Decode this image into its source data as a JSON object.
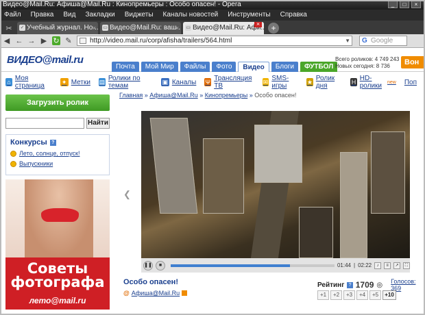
{
  "window": {
    "title": "Видео@Mail.Ru: Афиша@Mail.Ru : Кинопремьеры : Особо опасен! - Opera"
  },
  "menu": [
    "Файл",
    "Правка",
    "Вид",
    "Закладки",
    "Виджеты",
    "Каналы новостей",
    "Инструменты",
    "Справка"
  ],
  "tabs": [
    {
      "label": "Учебный журнал. Но ..."
    },
    {
      "label": "Видео@Mail.Ru: ваш ..."
    },
    {
      "label": "Видео@Mail.Ru: Афи..."
    }
  ],
  "address": {
    "url": "http://video.mail.ru/corp/afisha/trailers/564.html",
    "search_placeholder": "Google"
  },
  "site": {
    "logo": "ВИДЕО@mail.ru",
    "tabs": [
      "Почта",
      "Мой Мир",
      "Файлы",
      "Фото",
      "Видео",
      "Блоги",
      "ФУТБОЛ"
    ],
    "stats_line1": "Всего роликов: 4 749 243",
    "stats_line2": "Новых сегодня: 8 736",
    "orange_btn": "Вон"
  },
  "links": [
    {
      "label": "Моя страница",
      "icon": "home-icon",
      "color": "#3a8fd8"
    },
    {
      "label": "Метки",
      "icon": "tag-icon",
      "color": "#f0a000"
    },
    {
      "label": "Ролики по темам",
      "icon": "film-icon",
      "color": "#3a8fd8"
    },
    {
      "label": "Каналы",
      "icon": "tv-icon",
      "color": "#3a6fc0"
    },
    {
      "label": "Трансляция ТВ",
      "icon": "antenna-icon",
      "color": "#e06a00"
    },
    {
      "label": "SMS-игры",
      "icon": "sms-icon",
      "color": "#f0b400"
    },
    {
      "label": "Ролик дня",
      "icon": "clapper-icon",
      "color": "#d0a000"
    },
    {
      "label": "HD-ролики",
      "icon": "hd-icon",
      "color": "#333333",
      "badge": "new"
    },
    {
      "label": "Поп",
      "icon": "",
      "color": ""
    }
  ],
  "sidebar": {
    "upload": "Загрузить ролик",
    "search_btn": "Найти",
    "contests_title": "Конкурсы",
    "contests": [
      "Лето, солнце, отпуск!",
      "Выпускники"
    ],
    "ad_line1": "Советы",
    "ad_line2": "фотографа",
    "ad_brand": "лето@mail.ru"
  },
  "breadcrumbs": {
    "items": [
      "Главная",
      "Афиша@Mail.Ru",
      "Кинопремьеры"
    ],
    "current": "Особо опасен!"
  },
  "player": {
    "time_current": "01:44",
    "time_total": "02:22",
    "progress": 0.73
  },
  "video_info": {
    "title": "Особо опасен!",
    "author": "Афиша@Mail.Ru"
  },
  "rating": {
    "label": "Рейтинг",
    "value": "1709",
    "votes": "Голосов: 369",
    "buttons": [
      "+1",
      "+2",
      "+3",
      "+4",
      "+5",
      "+10"
    ]
  }
}
